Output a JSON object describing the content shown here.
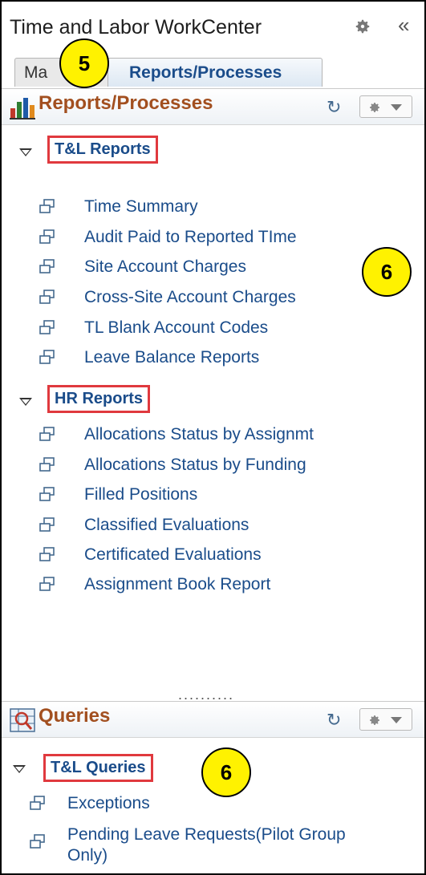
{
  "workcenter": {
    "title": "Time and Labor WorkCenter",
    "collapse_glyph": "«"
  },
  "tabs": [
    {
      "label": "My",
      "partial_label": "Ma"
    },
    {
      "label": "Reports/Processes"
    }
  ],
  "reports_pagelet": {
    "title": "Reports/Processes",
    "refresh_glyph": "↻",
    "groups": [
      {
        "label": "T&L Reports",
        "items": [
          {
            "label": "Time Summary"
          },
          {
            "label": "Audit Paid to Reported TIme"
          },
          {
            "label": "Site Account Charges"
          },
          {
            "label": "Cross-Site Account Charges"
          },
          {
            "label": "TL Blank Account Codes"
          },
          {
            "label": "Leave Balance Reports"
          }
        ]
      },
      {
        "label": "HR Reports",
        "items": [
          {
            "label": "Allocations Status by Assignmt"
          },
          {
            "label": "Allocations Status by Funding"
          },
          {
            "label": "Filled Positions"
          },
          {
            "label": "Classified Evaluations"
          },
          {
            "label": "Certificated Evaluations"
          },
          {
            "label": "Assignment Book Report"
          }
        ]
      }
    ]
  },
  "splitter": "..........",
  "queries_pagelet": {
    "title": "Queries",
    "refresh_glyph": "↻",
    "groups": [
      {
        "label": "T&L Queries",
        "items": [
          {
            "label": "Exceptions"
          },
          {
            "label": "Pending Leave Requests(Pilot Group Only)"
          }
        ]
      }
    ]
  },
  "callouts": [
    {
      "label": "5"
    },
    {
      "label": "6"
    },
    {
      "label": "6"
    }
  ],
  "colors": {
    "link": "#1a4c8a",
    "pagelet_title": "#a24f1f",
    "highlight_box": "#e0393e",
    "callout_fill": "#fff200"
  }
}
